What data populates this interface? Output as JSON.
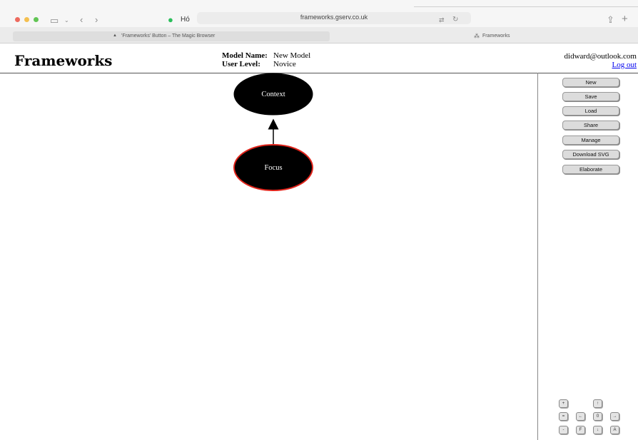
{
  "browser": {
    "address": "frameworks.gserv.co.uk",
    "ext_label": "Hó",
    "tabs": [
      {
        "label": "'Frameworks' Button – The Magic Browser"
      },
      {
        "label": "Frameworks"
      }
    ]
  },
  "app": {
    "title": "Frameworks",
    "model_name_label": "Model Name:",
    "model_name_value": "New Model",
    "user_level_label": "User Level:",
    "user_level_value": "Novice",
    "user_email": "didward@outlook.com",
    "logout_label": "Log out"
  },
  "sidebar": {
    "buttons": [
      "New",
      "Save",
      "Load",
      "Share",
      "Manage",
      "Download SVG",
      "Elaborate"
    ]
  },
  "diagram": {
    "nodes": [
      {
        "label": "Context",
        "fill": "#000000",
        "stroke": "#000000"
      },
      {
        "label": "Focus",
        "fill": "#000000",
        "stroke": "#e0241b"
      }
    ],
    "edges": [
      {
        "from": "Focus",
        "to": "Context"
      }
    ]
  },
  "controls": {
    "zoom_in": "+",
    "up": "↑",
    "reset": "=",
    "left": "←",
    "zero": "0",
    "right": "→",
    "zoom_out": "-",
    "fit": "F",
    "down": "↓",
    "all": "A"
  }
}
